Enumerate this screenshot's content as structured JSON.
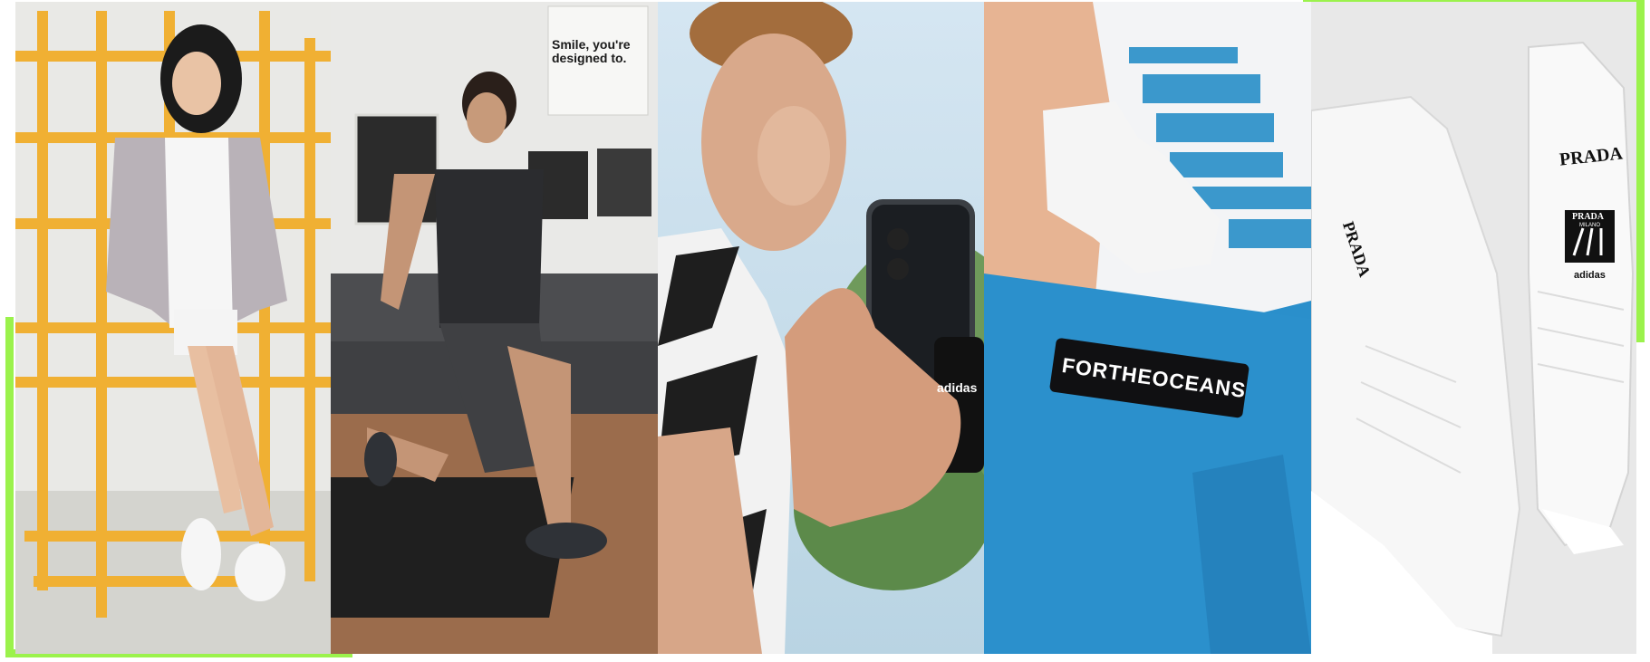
{
  "collage": {
    "panels": [
      {
        "id": "panel-1",
        "subject": "woman posing on yellow climbing frame",
        "bg": "#eeeeec",
        "accent": "#f2b43a"
      },
      {
        "id": "panel-2",
        "subject": "man lunging on yoga mat",
        "bg": "#ececea",
        "poster_text": "Smile, you're designed to."
      },
      {
        "id": "panel-3",
        "subject": "woman holding phone with adidas grip",
        "bg": "#cfe2ef",
        "phone_logo": "adidas"
      },
      {
        "id": "panel-4",
        "subject": "blue shorts with ocean label",
        "bg": "#2d93cf",
        "label_text": "FORTHEOCEANS"
      },
      {
        "id": "panel-5",
        "subject": "white sneakers collaboration",
        "bg": "#e9e9e9",
        "brand_a": "PRADA",
        "brand_b": "adidas",
        "brand_sub": "MILANO"
      }
    ]
  },
  "colors": {
    "accent_frame": "#9bf24c"
  }
}
